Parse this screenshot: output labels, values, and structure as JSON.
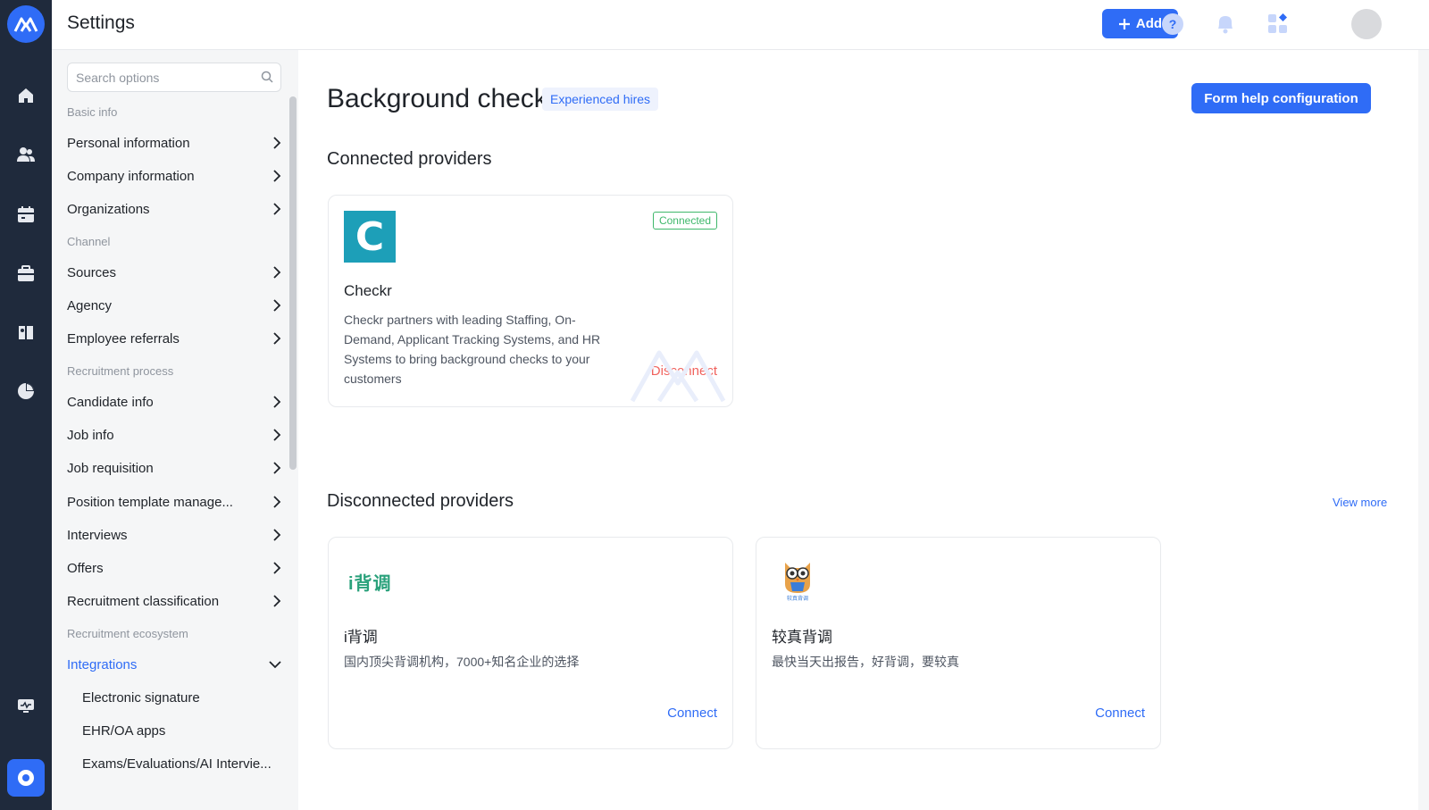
{
  "header": {
    "title": "Settings",
    "add_label": "Add"
  },
  "sidebar": {
    "search_placeholder": "Search options",
    "sections": [
      {
        "label": "Basic info",
        "items": [
          "Personal information",
          "Company information",
          "Organizations"
        ]
      },
      {
        "label": "Channel",
        "items": [
          "Sources",
          "Agency",
          "Employee referrals"
        ]
      },
      {
        "label": "Recruitment process",
        "items": [
          "Candidate info",
          "Job info",
          "Job requisition",
          "Position template manage...",
          "Interviews",
          "Offers",
          "Recruitment classification"
        ]
      },
      {
        "label": "Recruitment ecosystem",
        "items": [
          "Integrations"
        ]
      }
    ],
    "integrations_children": [
      "Electronic signature",
      "EHR/OA apps",
      "Exams/Evaluations/AI Intervie..."
    ]
  },
  "main": {
    "page_title": "Background check",
    "tag": "Experienced hires",
    "form_help_label": "Form help configuration",
    "connected_title": "Connected providers",
    "disconnected_title": "Disconnected providers",
    "view_more": "View more",
    "connected": [
      {
        "logo_letter": "C",
        "name": "Checkr",
        "status": "Connected",
        "description": "Checkr partners with leading Staffing, On-Demand, Applicant Tracking Systems, and HR Systems to bring background checks to your customers",
        "action": "Disconnect"
      }
    ],
    "disconnected": [
      {
        "logo_text": "i背调",
        "name": "i背调",
        "description": "国内顶尖背调机构，7000+知名企业的选择",
        "action": "Connect"
      },
      {
        "logo_caption": "较真背调",
        "name": "较真背调",
        "description": "最快当天出报告，好背调，要较真",
        "action": "Connect"
      }
    ]
  },
  "colors": {
    "brand": "#2f6cf6",
    "rail": "#1f2a3c",
    "connected_green": "#3fb86b",
    "disconnect_red": "#f0625d",
    "checkr_teal": "#1d9fb8"
  },
  "icons": {
    "rail": [
      "logo-icon",
      "home-icon",
      "people-icon",
      "calendar-icon",
      "briefcase-icon",
      "book-icon",
      "pie-chart-icon",
      "monitor-icon",
      "settings-icon"
    ],
    "header": [
      "plus-icon",
      "help-icon",
      "bell-icon",
      "apps-icon"
    ]
  }
}
